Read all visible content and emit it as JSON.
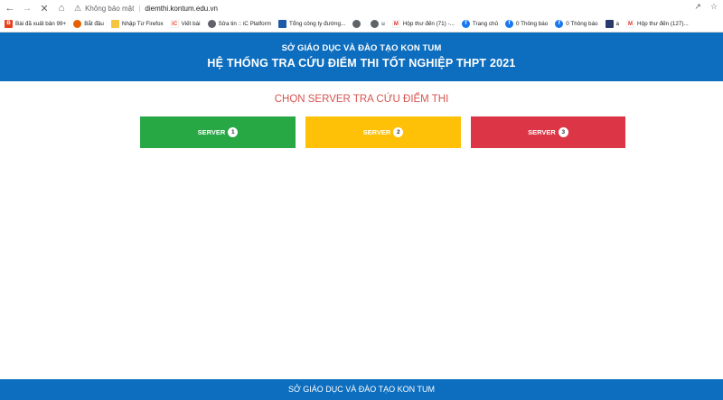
{
  "browser": {
    "security_label": "Không bảo mật",
    "url": "diemthi.kontum.edu.vn",
    "bookmarks": [
      {
        "label": "Bài đã xuất bản 99+",
        "icon": "blogger-icon",
        "color": "#e8411f",
        "text": "B"
      },
      {
        "label": "Bắt đầu",
        "icon": "firefox-icon",
        "color": "#e66000",
        "text": ""
      },
      {
        "label": "Nhập Từ Firefox",
        "icon": "folder-icon",
        "color": "#f5c542",
        "text": ""
      },
      {
        "label": "Viết bài",
        "icon": "ic-logo-icon",
        "color": "#ffffff",
        "text": "iC"
      },
      {
        "label": "Sửa tin :: iC Platform",
        "icon": "globe-icon",
        "color": "#5f6368",
        "text": ""
      },
      {
        "label": "Tổng công ty đường...",
        "icon": "company-logo-icon",
        "color": "#1e5aa8",
        "text": ""
      },
      {
        "label": "",
        "icon": "globe-icon",
        "color": "#5f6368",
        "text": ""
      },
      {
        "label": "u",
        "icon": "globe-icon",
        "color": "#5f6368",
        "text": ""
      },
      {
        "label": "Hộp thư đến (71) -...",
        "icon": "gmail-icon",
        "color": "#ffffff",
        "text": "M"
      },
      {
        "label": "Trang chủ",
        "icon": "facebook-icon",
        "color": "#1877f2",
        "text": "f"
      },
      {
        "label": "0 Thông báo",
        "icon": "facebook-icon",
        "color": "#1877f2",
        "text": "f"
      },
      {
        "label": "0 Thông báo",
        "icon": "facebook-icon",
        "color": "#1877f2",
        "text": "f"
      },
      {
        "label": "a",
        "icon": "bookmark-page-icon",
        "color": "#2a3a6a",
        "text": ""
      },
      {
        "label": "Hộp thư đến (127)...",
        "icon": "gmail-icon",
        "color": "#ffffff",
        "text": "M"
      }
    ]
  },
  "header": {
    "line1": "SỞ GIÁO DỤC VÀ ĐÀO TẠO KON TUM",
    "line2": "HỆ THỐNG TRA CỨU ĐIỂM THI TỐT NGHIỆP THPT 2021"
  },
  "main": {
    "choose_title": "CHỌN SERVER TRA CỨU ĐIỂM THI",
    "servers": [
      {
        "label": "SERVER",
        "number": "1",
        "color": "#28a745"
      },
      {
        "label": "SERVER",
        "number": "2",
        "color": "#ffc107"
      },
      {
        "label": "SERVER",
        "number": "3",
        "color": "#dc3545"
      }
    ]
  },
  "footer": {
    "text": "SỞ GIÁO DỤC VÀ ĐÀO TẠO KON TUM"
  }
}
